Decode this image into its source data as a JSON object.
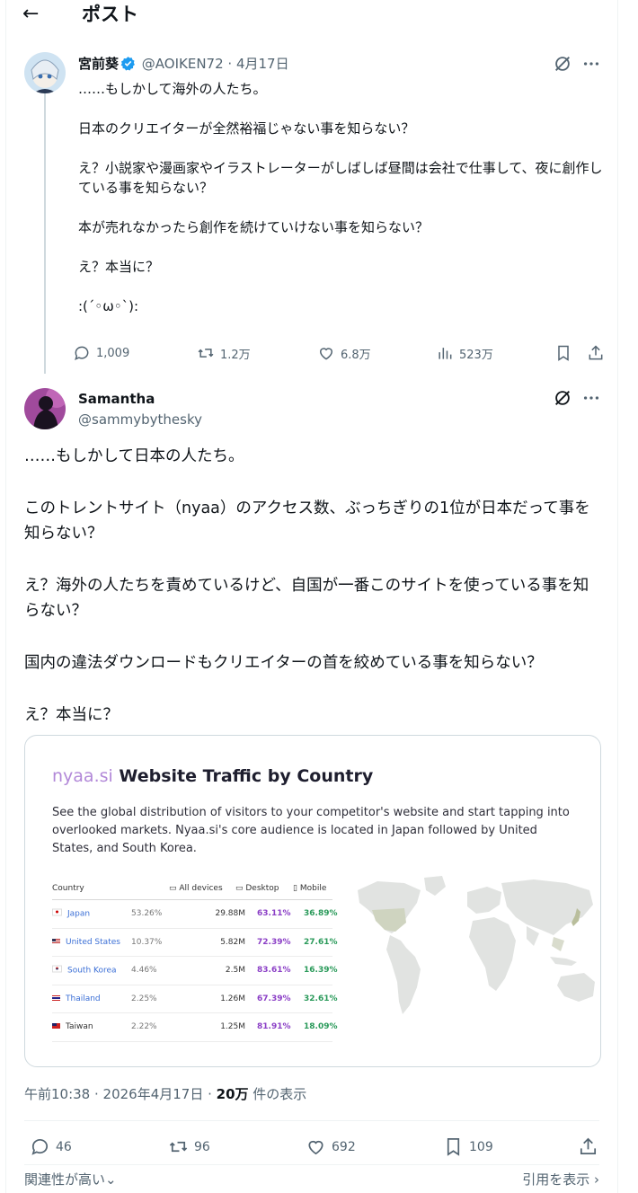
{
  "header": {
    "back_icon": "arrow-left-icon",
    "title": "ポスト"
  },
  "quoted_post": {
    "display_name": "宮前葵",
    "verified": true,
    "handle": "@AOIKEN72",
    "date": "4月17日",
    "paragraphs": [
      "……もしかして海外の人たち。",
      "日本のクリエイターが全然裕福じゃない事を知らない？",
      "え？小説家や漫画家やイラストレーターがしばしば昼間は会社で仕事して、夜に創作している事を知らない？",
      "本が売れなかったら創作を続けていけない事を知らない？",
      "え？本当に？",
      ":(´◦ω◦`):"
    ],
    "replies": "1,009",
    "reposts": "1.2万",
    "likes": "6.8万",
    "views": "523万"
  },
  "main_post": {
    "display_name": "Samantha",
    "handle": "@sammybythesky",
    "paragraphs": [
      "……もしかして日本の人たち。",
      "このトレントサイト（nyaa）のアクセス数、ぶっちぎりの1位が日本だって事を知らない？",
      "え？海外の人たちを責めているけど、自国が一番このサイトを使っている事を知らない？",
      "国内の違法ダウンロードもクリエイターの首を絞めている事を知らない？",
      "え？本当に？"
    ],
    "image": {
      "brand": "nyaa.si",
      "title": "Website Traffic by Country",
      "description": "See the global distribution of visitors to your competitor's website and start tapping into overlooked markets. Nyaa.si's core audience is located in Japan followed by United States, and South Korea.",
      "columns": {
        "country": "Country",
        "all": "All devices",
        "desktop": "Desktop",
        "mobile": "Mobile"
      },
      "rows": [
        {
          "country": "Japan",
          "share": "53.26%",
          "all": "29.88M",
          "desktop": "63.11%",
          "mobile": "36.89%"
        },
        {
          "country": "United States",
          "share": "10.37%",
          "all": "5.82M",
          "desktop": "72.39%",
          "mobile": "27.61%"
        },
        {
          "country": "South Korea",
          "share": "4.46%",
          "all": "2.5M",
          "desktop": "83.61%",
          "mobile": "16.39%"
        },
        {
          "country": "Thailand",
          "share": "2.25%",
          "all": "1.26M",
          "desktop": "67.39%",
          "mobile": "32.61%"
        },
        {
          "country": "Taiwan",
          "share": "2.22%",
          "all": "1.25M",
          "desktop": "81.91%",
          "mobile": "18.09%"
        }
      ]
    },
    "timestamp": "午前10:38 · 2026年4月17日 · ",
    "views_count": "20万",
    "views_suffix": " 件の表示",
    "replies": "46",
    "reposts": "96",
    "likes": "692",
    "bookmarks": "109"
  },
  "footer": {
    "sort_label": "関連性が高い",
    "quotes_label": "引用を表示"
  },
  "colors": {
    "accent": "#1d9bf0",
    "muted": "#536471",
    "desktop": "#8b3fc6",
    "mobile": "#2a9a5a"
  }
}
